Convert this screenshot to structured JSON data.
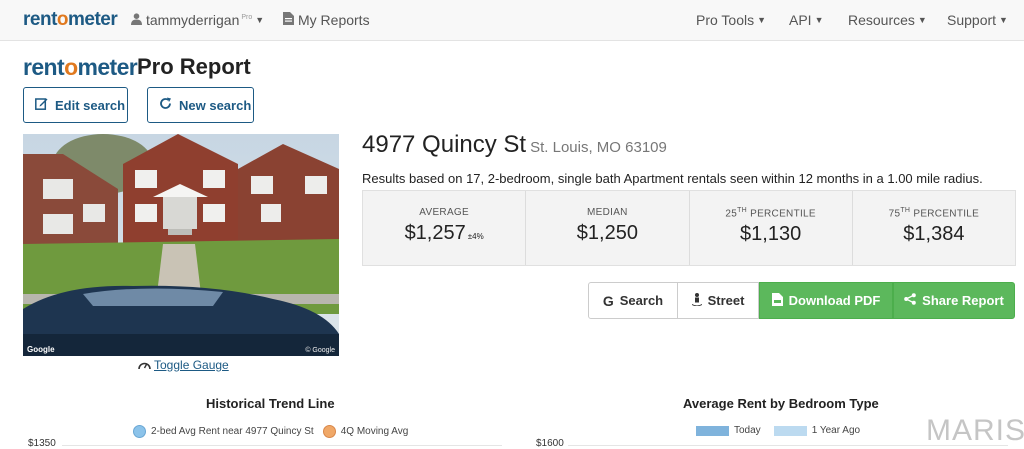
{
  "navbar": {
    "brand_a": "rent",
    "brand_o": "o",
    "brand_b": "meter",
    "user": "tammyderrigan",
    "user_badge": "Pro",
    "my_reports": "My Reports",
    "pro_tools": "Pro Tools",
    "api": "API",
    "resources": "Resources",
    "support": "Support"
  },
  "header": {
    "logo_a": "rent",
    "logo_o": "o",
    "logo_b": "meter",
    "title": "Pro Report",
    "edit_search": "Edit search",
    "new_search": "New search"
  },
  "property": {
    "street": "4977 Quincy St",
    "city": "St. Louis, MO 63109",
    "summary": "Results based on 17, 2-bedroom, single bath Apartment rentals seen within 12 months in a 1.00 mile radius.",
    "photo_google": "Google",
    "photo_copy": "© Google",
    "toggle_gauge": "Toggle Gauge"
  },
  "stats": {
    "average_label": "AVERAGE",
    "average_value": "$1,257",
    "average_margin": "±4%",
    "median_label": "MEDIAN",
    "median_value": "$1,250",
    "p25_num": "25",
    "p25_sup": "TH",
    "p25_label": " PERCENTILE",
    "p25_value": "$1,130",
    "p75_num": "75",
    "p75_sup": "TH",
    "p75_label": " PERCENTILE",
    "p75_value": "$1,384"
  },
  "actions": {
    "search": "Search",
    "street": "Street",
    "download_pdf": "Download PDF",
    "share_report": "Share Report"
  },
  "charts": {
    "trend_title": "Historical Trend Line",
    "trend_legend_1": "2-bed Avg Rent near 4977 Quincy St",
    "trend_legend_2": "4Q Moving Avg",
    "trend_ytick": "$1350",
    "bedroom_title": "Average Rent by Bedroom Type",
    "bedroom_legend_1": "Today",
    "bedroom_legend_2": "1 Year Ago",
    "bedroom_ytick": "$1600"
  },
  "colors": {
    "brand_blue": "#1d5a84",
    "brand_orange": "#e0791f",
    "green": "#5cb85c",
    "dot_blue": "#8cc3ea",
    "dot_orange": "#f0a868"
  },
  "watermark": "MARIS"
}
